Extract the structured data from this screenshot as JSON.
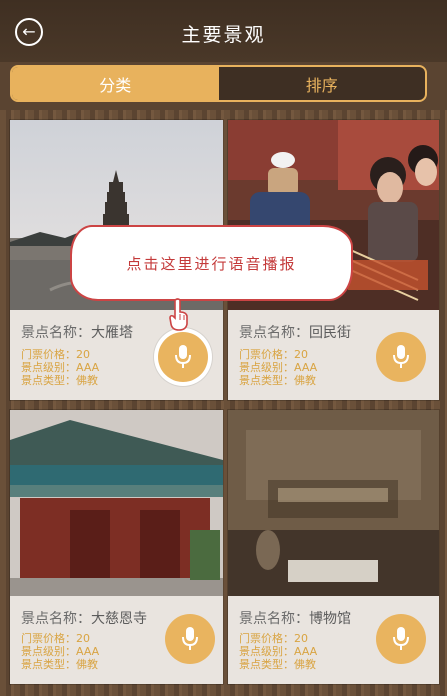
{
  "header": {
    "title": "主要景观",
    "back_icon": "arrow-left-icon"
  },
  "tabs": [
    {
      "label": "分类",
      "active": true
    },
    {
      "label": "排序",
      "active": false
    }
  ],
  "labels": {
    "name": "景点名称：",
    "price": "门票价格：",
    "level": "景点级别：",
    "type": "景点类型："
  },
  "spots": [
    {
      "name": "大雁塔",
      "price": "20",
      "level": "AAA",
      "type": "佛教",
      "image": "big-wild-goose-pagoda-photo"
    },
    {
      "name": "回民街",
      "price": "20",
      "level": "AAA",
      "type": "佛教",
      "image": "muslim-street-vendor-photo"
    },
    {
      "name": "大慈恩寺",
      "price": "20",
      "level": "AAA",
      "type": "佛教",
      "image": "daci-en-temple-gate-photo"
    },
    {
      "name": "博物馆",
      "price": "20",
      "level": "AAA",
      "type": "佛教",
      "image": "museum-wall-relief-photo"
    }
  ],
  "tooltip": {
    "text": "点击这里进行语音播报"
  },
  "colors": {
    "accent": "#e8b25d",
    "header": "#3f2f22",
    "detail_text": "#d9a442",
    "tooltip_border": "#cc4444"
  }
}
